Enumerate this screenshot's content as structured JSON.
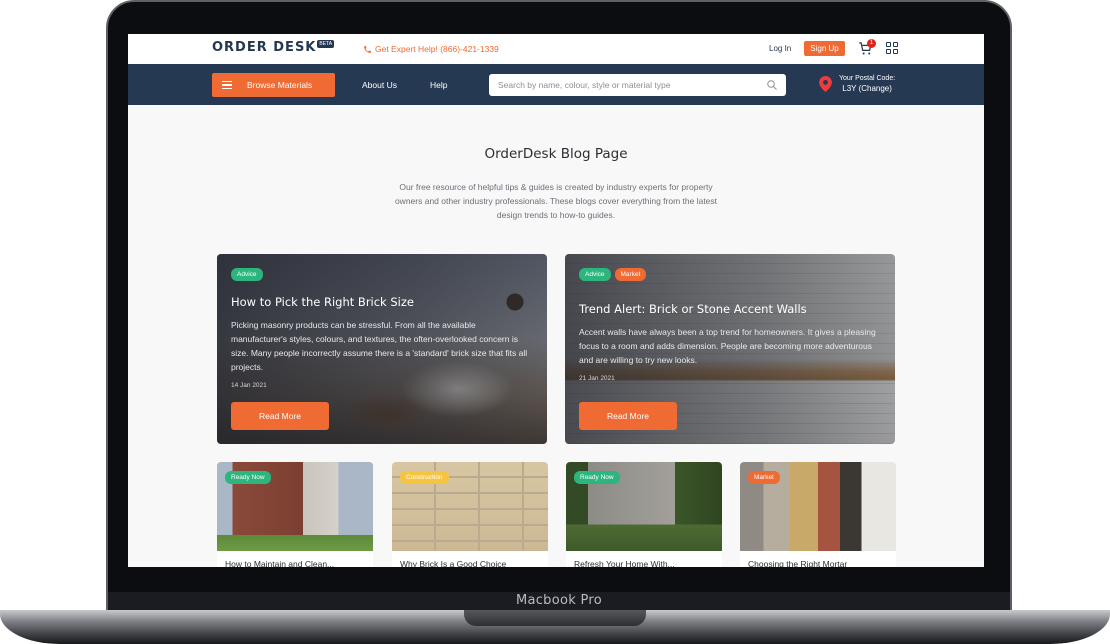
{
  "device": {
    "label": "Macbook Pro"
  },
  "topbar": {
    "logo": "ORDER DESK",
    "beta": "BETA",
    "phone": "Get Expert Help! (866)-421-1339",
    "login": "Log In",
    "signup": "Sign Up",
    "cart_count": "1"
  },
  "nav": {
    "browse": "Browse Materials",
    "about": "About Us",
    "help": "Help",
    "search_placeholder": "Search by name, colour, style or material type",
    "postal_label": "Your Postal Code:",
    "postal_value": "L3Y (Change)"
  },
  "page": {
    "title": "OrderDesk Blog Page",
    "description": "Our free resource of helpful tips & guides is created by industry experts for property owners and other industry professionals. These blogs cover everything from the latest design trends to how-to guides."
  },
  "featured": [
    {
      "tags": [
        "Advice"
      ],
      "title": "How to Pick the Right Brick Size",
      "excerpt": "Picking masonry products can be stressful. From all the available manufacturer's styles, colours, and textures, the often-overlooked concern is size. Many people incorrectly assume there is a 'standard' brick size that fits all projects.",
      "date": "14 Jan 2021",
      "button": "Read More"
    },
    {
      "tags": [
        "Advice",
        "Market"
      ],
      "title": "Trend Alert: Brick or Stone Accent Walls",
      "excerpt": "Accent walls have always been a top trend for homeowners. It gives a pleasing focus to a room and adds dimension. People are becoming more adventurous and are willing to try new looks.",
      "date": "21 Jan 2021",
      "button": "Read More"
    }
  ],
  "cards": [
    {
      "tag": "Ready Now",
      "tag_color": "#2cb67d",
      "title": "How to Maintain and Clean..."
    },
    {
      "tag": "Construction",
      "tag_color": "#f5c542",
      "title": "Why Brick Is a Good Choice"
    },
    {
      "tag": "Ready Now",
      "tag_color": "#2cb67d",
      "title": "Refresh Your Home With..."
    },
    {
      "tag": "Market",
      "tag_color": "#f06a33",
      "title": "Choosing the Right Mortar"
    }
  ],
  "colors": {
    "accent": "#f06a33",
    "navy": "#263952",
    "tag_green": "#2cb67d",
    "tag_yellow": "#f5c542"
  }
}
